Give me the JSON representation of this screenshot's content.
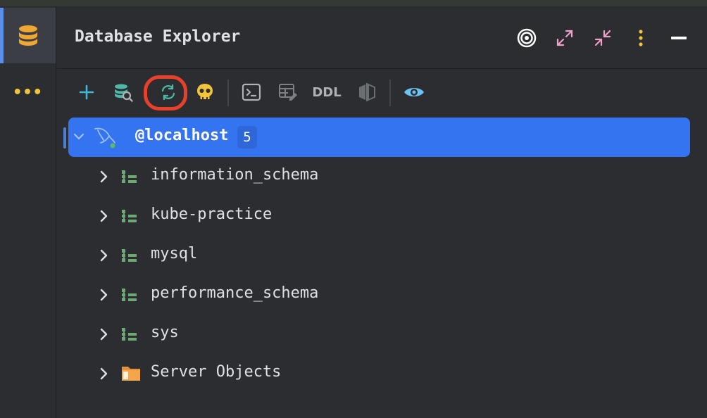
{
  "panel": {
    "title": "Database Explorer"
  },
  "sidebar": {
    "database_tab_icon": "database-icon",
    "more_label": "•••"
  },
  "header_icons": [
    "target-icon",
    "expand-icon",
    "collapse-icon",
    "kebab-menu-icon",
    "minimize-icon"
  ],
  "toolbar": {
    "icons": [
      "add-icon",
      "data-source-properties-icon",
      "refresh-icon",
      "skull-icon",
      "console-icon",
      "edit-table-icon",
      "ddl-text-button",
      "compare-icon",
      "eye-icon"
    ],
    "ddl_label": "DDL",
    "highlight": "refresh-icon"
  },
  "tree": {
    "host": {
      "label": "@localhost",
      "count": "5"
    },
    "items": [
      {
        "label": "information_schema",
        "icon": "schema-icon"
      },
      {
        "label": "kube-practice",
        "icon": "schema-icon"
      },
      {
        "label": "mysql",
        "icon": "schema-icon"
      },
      {
        "label": "performance_schema",
        "icon": "schema-icon"
      },
      {
        "label": "sys",
        "icon": "schema-icon"
      },
      {
        "label": "Server Objects",
        "icon": "folder-icon"
      }
    ]
  },
  "colors": {
    "background": "#2b2d30",
    "selection": "#3574f0",
    "highlight_ring": "#e8402b",
    "schema_green": "#6aab73",
    "folder_orange": "#e8903a"
  }
}
